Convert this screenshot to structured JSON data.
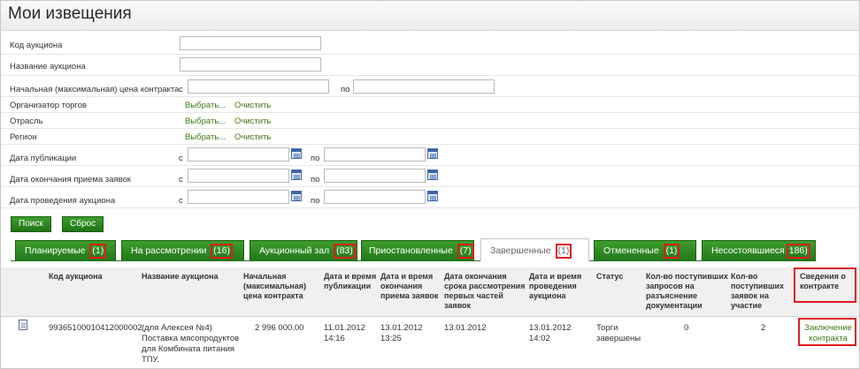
{
  "page": {
    "title": "Мои извещения"
  },
  "filters": {
    "auction_code": {
      "label": "Код аукциона",
      "value": ""
    },
    "auction_name": {
      "label": "Название аукциона",
      "value": ""
    },
    "max_price": {
      "label": "Начальная (максимальная) цена контракта",
      "from_label": "с",
      "to_label": "по",
      "from_value": "",
      "to_value": ""
    },
    "organizer": {
      "label": "Организатор торгов",
      "select": "Выбрать...",
      "clear": "Очистить"
    },
    "industry": {
      "label": "Отрасль",
      "select": "Выбрать...",
      "clear": "Очистить"
    },
    "region": {
      "label": "Регион",
      "select": "Выбрать...",
      "clear": "Очистить"
    },
    "publish_date": {
      "label": "Дата публикации",
      "from_label": "с",
      "to_label": "по",
      "from_value": "",
      "to_value": ""
    },
    "deadline_date": {
      "label": "Дата окончания приема заявок",
      "from_label": "с",
      "to_label": "по",
      "from_value": "",
      "to_value": ""
    },
    "auction_date": {
      "label": "Дата проведения аукциона",
      "from_label": "с",
      "to_label": "по",
      "from_value": "",
      "to_value": ""
    }
  },
  "buttons": {
    "search": "Поиск",
    "reset": "Сброс"
  },
  "tabs": [
    {
      "label": "Планируемые",
      "count": "(1)"
    },
    {
      "label": "На рассмотрении",
      "count": "(16)"
    },
    {
      "label": "Аукционный зал",
      "count": "(83)"
    },
    {
      "label": "Приостановленные",
      "count": "(7)"
    },
    {
      "label": "Завершенные",
      "count": "(1)"
    },
    {
      "label": "Отмененные",
      "count": "(1)"
    },
    {
      "label": "Несостоявшиеся",
      "count": "186)"
    }
  ],
  "table": {
    "headers": {
      "code": "Код аукциона",
      "name": "Название аукциона",
      "price": [
        "Начальная",
        "(максимальная)",
        "цена контракта"
      ],
      "published": [
        "Дата и время",
        "публикации"
      ],
      "deadline": [
        "Дата и время",
        "окончания",
        "приема заявок"
      ],
      "review_end": [
        "Дата окончания",
        "срока рассмотрения",
        "первых частей",
        "заявок"
      ],
      "held": [
        "Дата и время",
        "проведения",
        "аукциона"
      ],
      "status": "Статус",
      "clarification_requests": [
        "Кол-во поступивших",
        "запросов на",
        "разъяснение",
        "документации"
      ],
      "applications": [
        "Кол-во",
        "поступивших",
        "заявок на",
        "участие"
      ],
      "contract_info": [
        "Сведения о",
        "контракте"
      ]
    },
    "rows": [
      {
        "code": "9936510001041200000",
        "code_tail": "2",
        "name": [
          "(для Алексея №4)",
          "Поставка мясопродуктов",
          "для Комбината питания",
          "ТПУ."
        ],
        "price": "2 996 000.00",
        "published": [
          "11.01.2012",
          "14:16"
        ],
        "deadline": [
          "13.01.2012",
          "13:25"
        ],
        "review_end": "13.01.2012",
        "held": [
          "13.01.2012",
          "14:02"
        ],
        "status": [
          "Торги",
          "завершены"
        ],
        "clarification_requests": "0",
        "applications": "2",
        "contract_link": [
          "Заключение",
          "контракта"
        ]
      }
    ]
  },
  "colors": {
    "accent_green": "#2b8a1e",
    "link_green": "#3d7a18",
    "highlight_red": "#e01c1c"
  }
}
